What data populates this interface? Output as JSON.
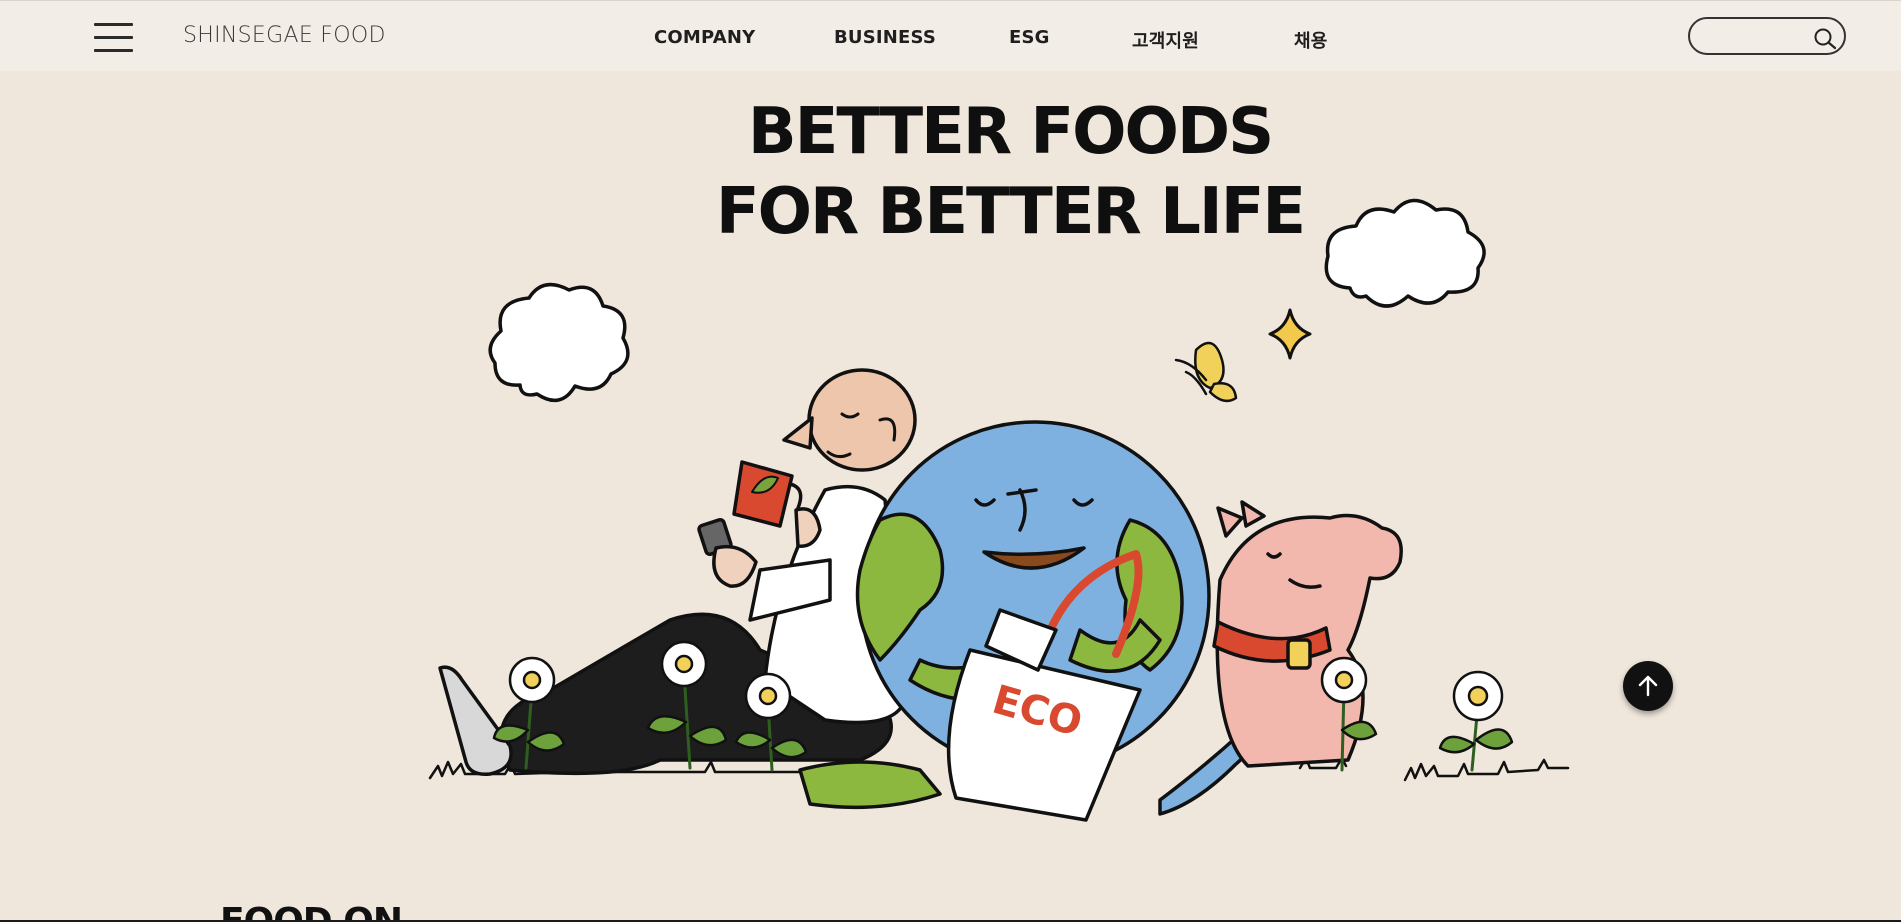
{
  "header": {
    "logo": "SHINSEGAE FOOD",
    "nav": [
      {
        "label": "COMPANY"
      },
      {
        "label": "BUSINESS"
      },
      {
        "label": "ESG"
      },
      {
        "label": "고객지원"
      },
      {
        "label": "채용"
      }
    ],
    "search": {
      "value": "",
      "placeholder": ""
    },
    "icons": {
      "menu": "hamburger-menu-icon",
      "search": "search-icon"
    }
  },
  "hero": {
    "title_line1": "BETTER FOODS",
    "title_line2": "FOR BETTER LIFE",
    "bag_text": "ECO"
  },
  "next_section": {
    "title": "FOOD ON"
  },
  "scroll_top": {
    "icon": "arrow-up-icon"
  },
  "colors": {
    "background": "#efe6dc",
    "header_bg": "#f3ede7",
    "earth_blue": "#7fb1e0",
    "earth_green": "#8db83f",
    "bag_red": "#d9492f",
    "pig_pink": "#f2b8ae",
    "butterfly_yellow": "#f2d15a"
  }
}
